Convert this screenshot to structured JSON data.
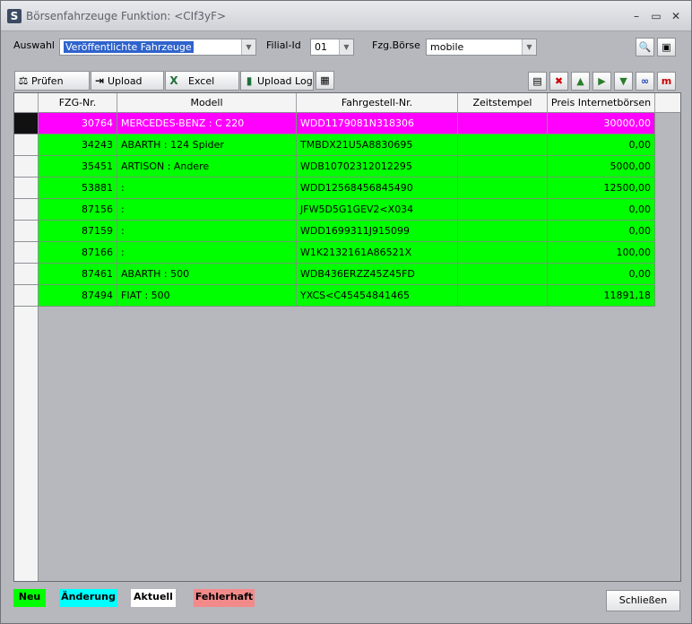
{
  "window": {
    "title": "Börsenfahrzeuge Funktion: <CIf3yF>",
    "app_icon": "S",
    "controls": [
      "–",
      "▭",
      "✕"
    ]
  },
  "filters": {
    "auswahl_label": "Auswahl",
    "auswahl_value": "Veröffentlichte Fahrzeuge",
    "filial_label": "Filial-Id",
    "filial_value": "01",
    "boerse_label": "Fzg.Börse",
    "boerse_value": "mobile"
  },
  "toolbar": {
    "pruefen": "Prüfen",
    "upload": "Upload",
    "excel": "Excel",
    "upload_log": "Upload Log"
  },
  "table": {
    "columns": [
      "FZG-Nr.",
      "Modell",
      "Fahrgestell-Nr.",
      "Zeitstempel",
      "Preis Internetbörsen"
    ],
    "rows": [
      {
        "fzg": "30764",
        "modell": "MERCEDES-BENZ : C 220",
        "fahrgestell": "WDD1179081N318306",
        "zeit": "",
        "preis": "30000,00",
        "status": "aktuell_sel"
      },
      {
        "fzg": "34243",
        "modell": "ABARTH : 124 Spider",
        "fahrgestell": "TMBDX21U5A8830695",
        "zeit": "",
        "preis": "0,00",
        "status": "neu"
      },
      {
        "fzg": "35451",
        "modell": "ARTISON : Andere",
        "fahrgestell": "WDB10702312012295",
        "zeit": "",
        "preis": "5000,00",
        "status": "neu"
      },
      {
        "fzg": "53881",
        "modell": ":",
        "fahrgestell": "WDD12568456845490",
        "zeit": "",
        "preis": "12500,00",
        "status": "neu"
      },
      {
        "fzg": "87156",
        "modell": ":",
        "fahrgestell": "JFW5D5G1GEV2<X034",
        "zeit": "",
        "preis": "0,00",
        "status": "neu"
      },
      {
        "fzg": "87159",
        "modell": ":",
        "fahrgestell": "WDD1699311J915099",
        "zeit": "",
        "preis": "0,00",
        "status": "neu"
      },
      {
        "fzg": "87166",
        "modell": ":",
        "fahrgestell": "W1K2132161A86521X",
        "zeit": "",
        "preis": "100,00",
        "status": "neu"
      },
      {
        "fzg": "87461",
        "modell": "ABARTH : 500",
        "fahrgestell": "WDB436ERZZ45Z45FD",
        "zeit": "",
        "preis": "0,00",
        "status": "neu"
      },
      {
        "fzg": "87494",
        "modell": "FIAT : 500",
        "fahrgestell": "YXCS<C45454841465",
        "zeit": "",
        "preis": "11891,18",
        "status": "neu"
      }
    ]
  },
  "legend": {
    "neu": "Neu",
    "aenderung": "Änderung",
    "aktuell": "Aktuell",
    "fehlerhaft": "Fehlerhaft"
  },
  "colors": {
    "neu": "#00ff00",
    "aenderung": "#00ffff",
    "aktuell": "#ffffff",
    "fehlerhaft": "#f28a8a",
    "selected_row": "#ff00ff"
  },
  "close_label": "Schließen"
}
